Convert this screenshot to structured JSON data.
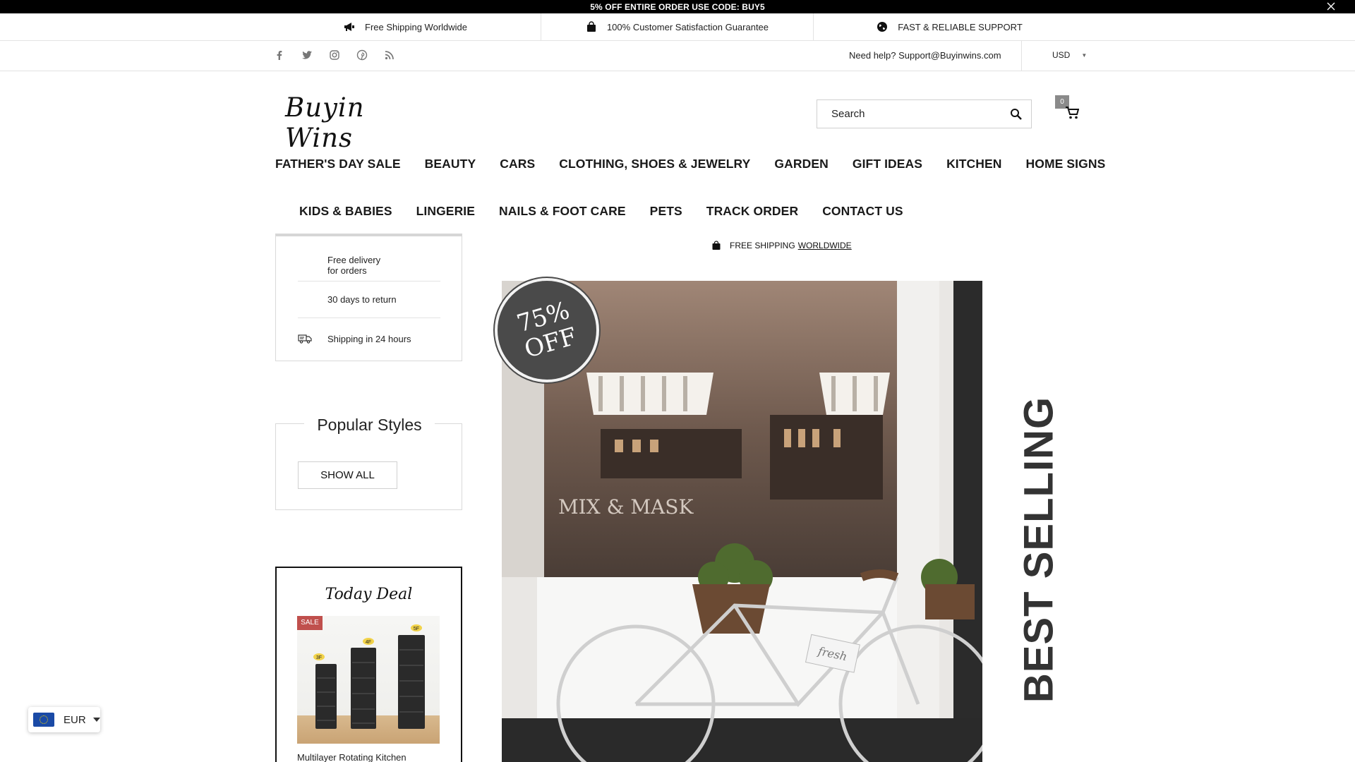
{
  "promo": {
    "text": "5% OFF ENTIRE ORDER USE CODE: BUY5",
    "close_icon": "close-icon"
  },
  "usps": [
    {
      "icon": "megaphone-icon",
      "text": "Free Shipping Worldwide"
    },
    {
      "icon": "shopping-bag-icon",
      "text": "100% Customer Satisfaction Guarantee"
    },
    {
      "icon": "globe-icon",
      "text": "FAST & RELIABLE SUPPORT"
    }
  ],
  "social": [
    "facebook-icon",
    "twitter-icon",
    "instagram-icon",
    "pinterest-icon",
    "rss-icon"
  ],
  "help": {
    "text": "Need help? Support@Buyinwins.com"
  },
  "currency": {
    "selected": "USD"
  },
  "logo": {
    "text": "Buyin Wins"
  },
  "search": {
    "placeholder": "Search"
  },
  "cart": {
    "count": "0"
  },
  "nav": {
    "row1": [
      "FATHER'S DAY SALE",
      "BEAUTY",
      "CARS",
      "CLOTHING, SHOES & JEWELRY",
      "GARDEN",
      "GIFT IDEAS",
      "KITCHEN",
      "HOME SIGNS"
    ],
    "row2": [
      "KIDS & BABIES",
      "LINGERIE",
      "NAILS & FOOT CARE",
      "PETS",
      "TRACK ORDER",
      "CONTACT US"
    ]
  },
  "services": [
    {
      "line1": "Free delivery",
      "line2": "for orders"
    },
    {
      "line1": "30 days to return"
    },
    {
      "line1": "Shipping in 24 hours"
    }
  ],
  "popular": {
    "title": "Popular Styles",
    "button": "SHOW ALL"
  },
  "deal": {
    "title": "Today Deal",
    "badge": "SALE",
    "tiers": [
      "3F",
      "4F",
      "5F"
    ],
    "name": "Multilayer Rotating Kitchen"
  },
  "shipping_note": {
    "prefix": "FREE SHIPPING",
    "link": "WORLDWIDE"
  },
  "hero": {
    "badge_line1": "75%",
    "badge_line2": "OFF",
    "window_text": "MIX & MASK",
    "basket_sign": "fresh"
  },
  "best_selling": {
    "text": "BEST SELLING"
  },
  "currency_widget": {
    "code": "EUR"
  },
  "colors": {
    "promo_bg": "#000000",
    "sale_badge": "#c0504d",
    "badge_bg": "#4a4a4a",
    "best_selling": "#333333",
    "eu_blue": "#1a4aa6"
  }
}
